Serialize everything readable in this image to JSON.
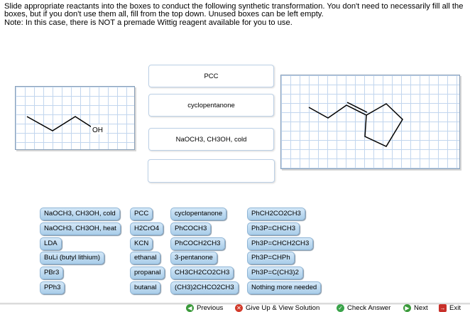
{
  "instructions": {
    "line1": "Slide appropriate reactants into the boxes to conduct the following synthetic transformation.  You don't need to necessarily fill all the boxes, but if you don't use them all, fill from the top down.  Unused boxes can be left empty.",
    "line2": "Note:  In this case, there is NOT a premade Wittig reagent available for you to use."
  },
  "starting_material": {
    "oh_label": "OH"
  },
  "drop_slots": [
    "PCC",
    "cyclopentanone",
    "NaOCH3, CH3OH, cold",
    ""
  ],
  "reagents": {
    "col1": [
      "NaOCH3, CH3OH, cold",
      "NaOCH3, CH3OH, heat",
      "LDA",
      "BuLi (butyl lithium)",
      "PBr3",
      "PPh3"
    ],
    "col2": [
      "PCC",
      "H2CrO4",
      "KCN",
      "ethanal",
      "propanal",
      "butanal"
    ],
    "col3": [
      "cyclopentanone",
      "PhCOCH3",
      "PhCOCH2CH3",
      "3-pentanone",
      "CH3CH2CO2CH3",
      "(CH3)2CHCO2CH3"
    ],
    "col4": [
      "PhCH2CO2CH3",
      "Ph3P=CHCH3",
      "Ph3P=CHCH2CH3",
      "Ph3P=CHPh",
      "Ph3P=C(CH3)2",
      "Nothing more needed"
    ]
  },
  "nav": {
    "previous": "Previous",
    "solution": "Give Up & View Solution",
    "check": "Check Answer",
    "next": "Next",
    "exit": "Exit"
  }
}
